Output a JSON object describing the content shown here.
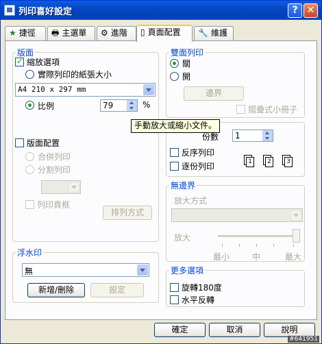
{
  "window": {
    "title": "列印喜好設定"
  },
  "tabs": [
    {
      "label": "捷徑",
      "icon": "star-icon"
    },
    {
      "label": "主選單",
      "icon": "printer-icon"
    },
    {
      "label": "進階",
      "icon": "gear-icon"
    },
    {
      "label": "頁面配置",
      "icon": "page-icon",
      "active": true
    },
    {
      "label": "維護",
      "icon": "wrench-icon"
    }
  ],
  "layout": {
    "legend": "版面",
    "zoom_option": "縮放選項",
    "actual_paper_size": "實際列印的紙張大小",
    "paper_select_value": "A4 210 x 297 mm",
    "scale_label": "比例",
    "scale_value": "79",
    "scale_unit": "%",
    "page_layout": "版面配置",
    "combine_print": "合併列印",
    "split_print": "分割列印",
    "print_frame": "列印頁框",
    "arrange_button": "排列方式"
  },
  "tooltip": "手動放大或縮小文件。",
  "duplex": {
    "legend": "雙面列印",
    "on": "關",
    "off": "開",
    "margin_button": "邊界",
    "booklet": "摺疊式小冊子"
  },
  "copies": {
    "label": "份數",
    "value": "1",
    "reverse": "反序列印",
    "collate": "逐份列印"
  },
  "borderless": {
    "legend": "無邊界",
    "enlarge_method": "放大方式",
    "enlarge": "放大",
    "min": "最小",
    "mid": "中",
    "max": "最大",
    "slider_level": 1.0
  },
  "watermark": {
    "legend": "浮水印",
    "value": "無",
    "add_delete_button": "新增/刪除",
    "settings_button": "設定"
  },
  "more": {
    "legend": "更多選項",
    "rotate": "旋轉180度",
    "mirror": "水平反轉"
  },
  "footer": {
    "ok": "確定",
    "cancel": "取消",
    "help": "說明"
  },
  "image_watermark": "#641951"
}
